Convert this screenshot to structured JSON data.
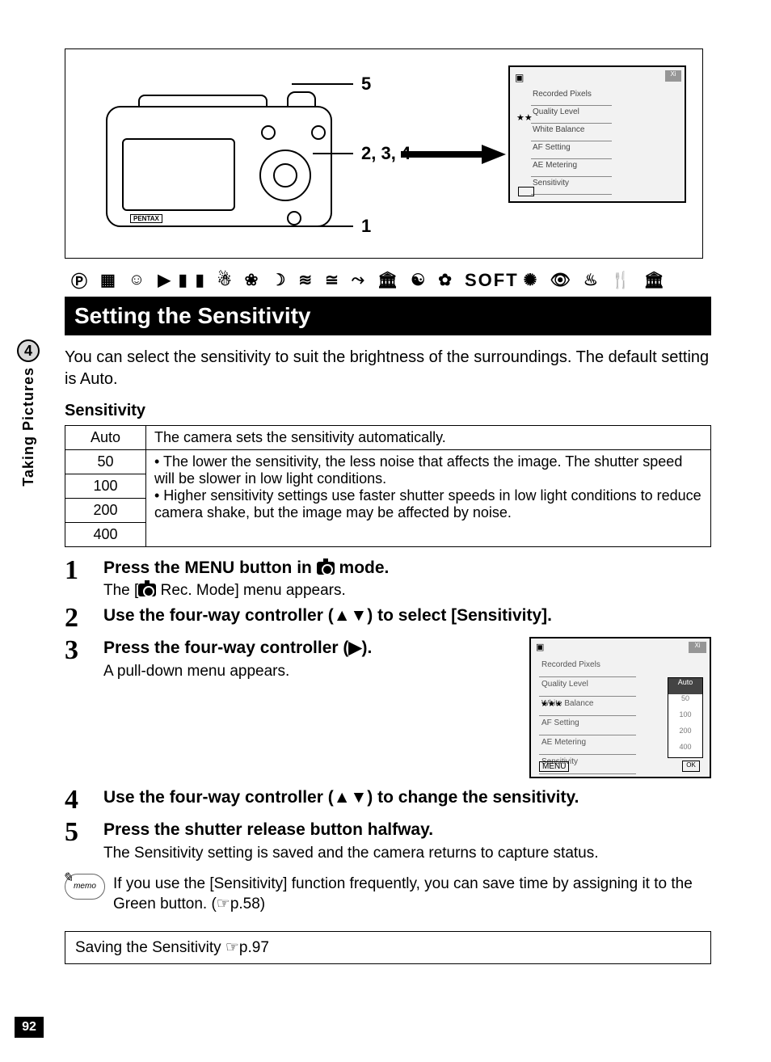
{
  "sideTab": {
    "number": "4",
    "label": "Taking Pictures"
  },
  "pageNumber": "92",
  "diagram": {
    "label5": "5",
    "label234": "2, 3, 4",
    "label1": "1",
    "brand": "PENTAX",
    "miniScreen": {
      "rows": [
        "Recorded Pixels",
        "Quality Level",
        "White Balance",
        "AF Setting",
        "AE Metering",
        "Sensitivity"
      ],
      "stars": "★★",
      "toolTab": "Xi"
    }
  },
  "modeRow": {
    "soft": "SOFT"
  },
  "titleBar": "Setting the Sensitivity",
  "intro": "You can select the sensitivity to suit the brightness of the surroundings. The default setting is Auto.",
  "subHead": "Sensitivity",
  "table": {
    "r1c1": "Auto",
    "r1c2": "The camera sets the sensitivity automatically.",
    "r2c1": "50",
    "r3c1": "100",
    "r4c1": "200",
    "r5c1": "400",
    "bulletsCombined": "• The lower the sensitivity, the less noise that affects the image. The shutter speed will be slower in low light conditions.\n• Higher sensitivity settings use faster shutter speeds in low light conditions to reduce camera shake, but the image may be affected by noise."
  },
  "steps": {
    "s1": {
      "num": "1",
      "titleA": "Press the ",
      "titleMenu": "MENU",
      "titleB": " button in ",
      "titleC": " mode.",
      "desc": "The [",
      "desc2": " Rec. Mode] menu appears."
    },
    "s2": {
      "num": "2",
      "title": "Use the four-way controller (▲▼) to select [Sensitivity]."
    },
    "s3": {
      "num": "3",
      "title": "Press the four-way controller (▶).",
      "desc": "A pull-down menu appears."
    },
    "s4": {
      "num": "4",
      "title": "Use the four-way controller (▲▼) to change the sensitivity."
    },
    "s5": {
      "num": "5",
      "title": "Press the shutter release button halfway.",
      "desc": "The Sensitivity setting is saved and the camera returns to capture status."
    }
  },
  "rightScreen": {
    "rows": [
      "Recorded Pixels",
      "Quality Level",
      "White Balance",
      "AF Setting",
      "AE Metering",
      "Sensitivity"
    ],
    "stars": "★★★",
    "toolTab": "Xi",
    "menu": "MENU",
    "ok": "OK",
    "options": [
      "Auto",
      "50",
      "100",
      "200",
      "400"
    ]
  },
  "memo": {
    "badge": "memo",
    "text": "If you use the [Sensitivity] function frequently, you can save time by assigning it to the Green button. (☞p.58)"
  },
  "bottomBox": "Saving the Sensitivity ☞p.97"
}
